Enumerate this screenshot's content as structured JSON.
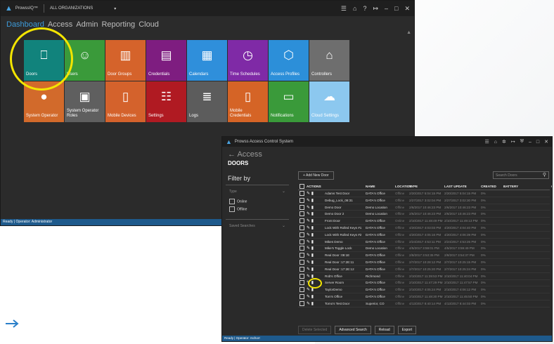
{
  "window1": {
    "app_name": "ProwssIQ™",
    "org_selector": "ALL ORGANIZATIONS",
    "nav": [
      {
        "label": "Dashboard",
        "active": true
      },
      {
        "label": "Access",
        "active": false
      },
      {
        "label": "Admin",
        "active": false
      },
      {
        "label": "Reporting",
        "active": false
      },
      {
        "label": "Cloud",
        "active": false
      }
    ],
    "tiles": [
      {
        "label": "Doors",
        "color": "#11837c",
        "icon": "door-icon"
      },
      {
        "label": "Users",
        "color": "#3a9a3a",
        "icon": "users-icon"
      },
      {
        "label": "Door Groups",
        "color": "#d5632b",
        "icon": "door-groups-icon"
      },
      {
        "label": "Credentials",
        "color": "#7e1d80",
        "icon": "credential-card-icon"
      },
      {
        "label": "Calendars",
        "color": "#2f8fdb",
        "icon": "calendar-icon"
      },
      {
        "label": "Time Schedules",
        "color": "#7f2aa6",
        "icon": "time-schedule-icon"
      },
      {
        "label": "Access Profiles",
        "color": "#2c8fd9",
        "icon": "access-profile-icon"
      },
      {
        "label": "Controllers",
        "color": "#6e6e6e",
        "icon": "controller-icon"
      },
      {
        "label": "System Operator",
        "color": "#d26a2b",
        "icon": "operator-icon"
      },
      {
        "label": "System Operator\nRoles",
        "color": "#5f5f5f",
        "icon": "operator-roles-icon"
      },
      {
        "label": "Mobile Devices",
        "color": "#d4622c",
        "icon": "mobile-device-icon"
      },
      {
        "label": "Settings",
        "color": "#b01a22",
        "icon": "settings-icon"
      },
      {
        "label": "Logs",
        "color": "#5c5c5c",
        "icon": "logs-icon"
      },
      {
        "label": "Mobile\nCredentials",
        "color": "#d56426",
        "icon": "mobile-credential-icon"
      },
      {
        "label": "Notifications",
        "color": "#3a9a3a",
        "icon": "notifications-icon"
      },
      {
        "label": "Cloud Settings",
        "color": "#8cc8ef",
        "icon": "cloud-icon"
      }
    ],
    "status": "Ready | Operator: Administrator"
  },
  "window2": {
    "title": "Prowss Access Control System",
    "back_label": "← Access",
    "page_title": "DOORS",
    "filter_by": "Filter by",
    "filter_type": "Type",
    "filter_online": "Online",
    "filter_offline": "Offline",
    "saved_searches": "Saved Searches",
    "add_button": "+ Add New Door",
    "search_placeholder": "Search Doors",
    "columns": [
      "ACTIONS",
      "NAME",
      "LOCATION",
      "TYPE",
      "LAST UPDATE",
      "CREATED",
      "BATTERY",
      "ONLINE CONTROLS"
    ],
    "rows": [
      {
        "name": "Adams Test Door",
        "location": "DATA's Office",
        "type": "Offline",
        "last_update": "2/20/2017 5:04:15 PM",
        "created": "2/20/2017 5:04:15 PM",
        "battery": "0%"
      },
      {
        "name": "Debug_Lock_08:31",
        "location": "DATA's Office",
        "type": "Offline",
        "last_update": "2/27/2017 3:02:04 PM",
        "created": "2/27/2017 3:02:30 PM",
        "battery": "0%"
      },
      {
        "name": "Demo Door",
        "location": "Demo Location",
        "type": "Offline",
        "last_update": "2/6/2017 10:46:23 PM",
        "created": "2/6/2017 10:46:23 PM",
        "battery": "0%"
      },
      {
        "name": "Demo Door 2",
        "location": "Demo Location",
        "type": "Offline",
        "last_update": "2/6/2017 10:46:23 PM",
        "created": "2/6/2017 10:46:23 PM",
        "battery": "0%"
      },
      {
        "name": "Front Door",
        "location": "DATA's Office",
        "type": "Online",
        "last_update": "2/10/2017 11:48:49 PM",
        "created": "2/10/2017 11:49:13 PM",
        "battery": "0%"
      },
      {
        "name": "Lock With Rolled Keys #1",
        "location": "DATA's Office",
        "type": "Offline",
        "last_update": "4/20/2017 4:03:03 PM",
        "created": "4/20/2017 4:04:40 PM",
        "battery": "0%"
      },
      {
        "name": "Lock With Rolled Keys #2",
        "location": "DATA's Office",
        "type": "Offline",
        "last_update": "4/20/2017 4:05:16 PM",
        "created": "4/20/2017 4:06:39 PM",
        "battery": "0%"
      },
      {
        "name": "Mikes Demo",
        "location": "DATA's Office",
        "type": "Offline",
        "last_update": "2/24/2017 4:53:11 PM",
        "created": "2/24/2017 4:53:26 PM",
        "battery": "0%"
      },
      {
        "name": "Mike's Toggle Lock",
        "location": "Demo Location",
        "type": "Offline",
        "last_update": "4/5/2017 3:59:01 PM",
        "created": "4/5/2017 3:59:49 PM",
        "battery": "0%"
      },
      {
        "name": "Real Door :08:1E",
        "location": "DATA's Office",
        "type": "Offline",
        "last_update": "2/8/2017 3:53:35 PM",
        "created": "2/8/2017 3:54:37 PM",
        "battery": "0%"
      },
      {
        "name": "Real Door :17:2E:11",
        "location": "DATA's Office",
        "type": "Offline",
        "last_update": "2/7/2017 10:28:12 PM",
        "created": "2/7/2017 10:25:15 PM",
        "battery": "0%"
      },
      {
        "name": "Real Door :17:2E:12",
        "location": "DATA's Office",
        "type": "Offline",
        "last_update": "2/7/2017 10:25:20 PM",
        "created": "2/7/2017 10:25:24 PM",
        "battery": "0%"
      },
      {
        "name": "Rob's Office",
        "location": "Richmond",
        "type": "Offline",
        "last_update": "2/10/2017 11:39:53 PM",
        "created": "2/10/2017 11:40:04 PM",
        "battery": "0%"
      },
      {
        "name": "Server Room",
        "location": "DATA's Office",
        "type": "Offline",
        "last_update": "2/10/2017 11:47:29 PM",
        "created": "2/10/2017 11:47:57 PM",
        "battery": "0%"
      },
      {
        "name": "TaylorDemo",
        "location": "DATA's Office",
        "type": "Offline",
        "last_update": "2/10/2017 4:05:24 PM",
        "created": "2/10/2017 4:06:12 PM",
        "battery": "0%"
      },
      {
        "name": "Tom's Office",
        "location": "DATA's Office",
        "type": "Offline",
        "last_update": "2/10/2017 11:48:30 PM",
        "created": "2/10/2017 11:45:50 PM",
        "battery": "0%"
      },
      {
        "name": "Tomo's Test Door",
        "location": "Superior, CO",
        "type": "Offline",
        "last_update": "4/13/2017 8:40:14 PM",
        "created": "4/13/2017 8:44:03 PM",
        "battery": "0%"
      }
    ],
    "buttons": {
      "delete": "Delete Selected",
      "advanced": "Advanced Search",
      "reload": "Reload",
      "export": "Export"
    },
    "status": "Ready | Operator: rschorr"
  },
  "colors": {
    "accent": "#3d9ad8",
    "highlight": "#f3e500",
    "status_bar": "#1e5a8c"
  }
}
